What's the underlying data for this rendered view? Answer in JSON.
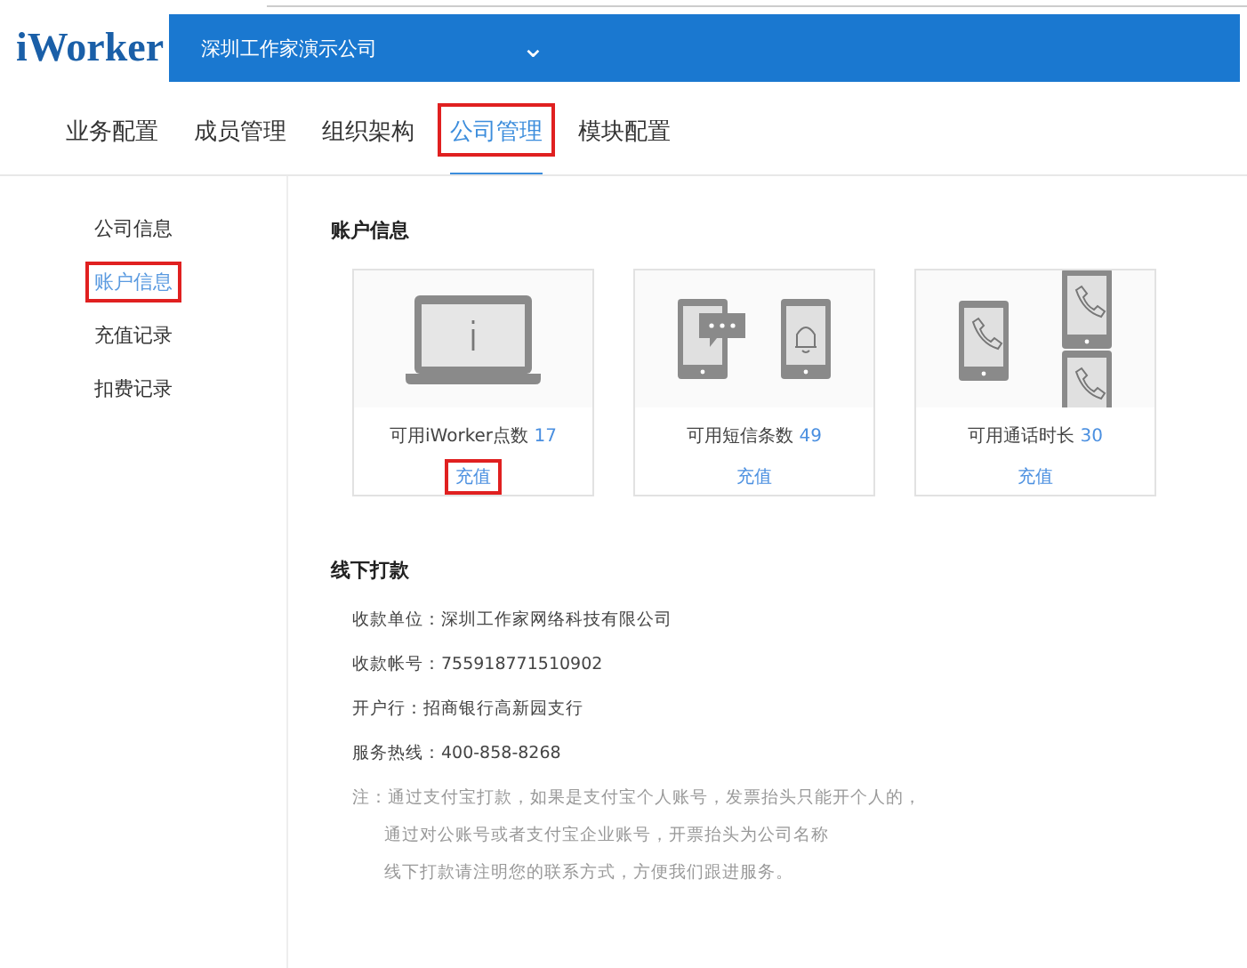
{
  "header": {
    "logo": "iWorker",
    "company": "深圳工作家演示公司",
    "dropdown": "⌄"
  },
  "tabs": [
    {
      "label": "业务配置",
      "selected": false,
      "highlighted": false
    },
    {
      "label": "成员管理",
      "selected": false,
      "highlighted": false
    },
    {
      "label": "组织架构",
      "selected": false,
      "highlighted": false
    },
    {
      "label": "公司管理",
      "selected": true,
      "highlighted": true
    },
    {
      "label": "模块配置",
      "selected": false,
      "highlighted": false
    }
  ],
  "sidebar": {
    "items": [
      {
        "label": "公司信息",
        "selected": false,
        "highlighted": false
      },
      {
        "label": "账户信息",
        "selected": true,
        "highlighted": true
      },
      {
        "label": "充值记录",
        "selected": false,
        "highlighted": false
      },
      {
        "label": "扣费记录",
        "selected": false,
        "highlighted": false
      }
    ]
  },
  "account": {
    "title": "账户信息",
    "cards": [
      {
        "kind": "laptop",
        "label": "可用iWorker点数",
        "value": "17",
        "action": "充值",
        "highlighted": true
      },
      {
        "kind": "sms",
        "label": "可用短信条数",
        "value": "49",
        "action": "充值",
        "highlighted": false
      },
      {
        "kind": "call",
        "label": "可用通话时长",
        "value": "30",
        "action": "充值",
        "highlighted": false
      }
    ]
  },
  "offline": {
    "title": "线下打款",
    "details": [
      "收款单位：深圳工作家网络科技有限公司",
      "收款帐号：755918771510902",
      "开户行：招商银行高新园支行",
      "服务热线：400-858-8268"
    ],
    "note": [
      "注：通过支付宝打款，如果是支付宝个人账号，发票抬头只能开个人的，",
      "通过对公账号或者支付宝企业账号，开票抬头为公司名称",
      "线下打款请注明您的联系方式，方便我们跟进服务。"
    ]
  }
}
